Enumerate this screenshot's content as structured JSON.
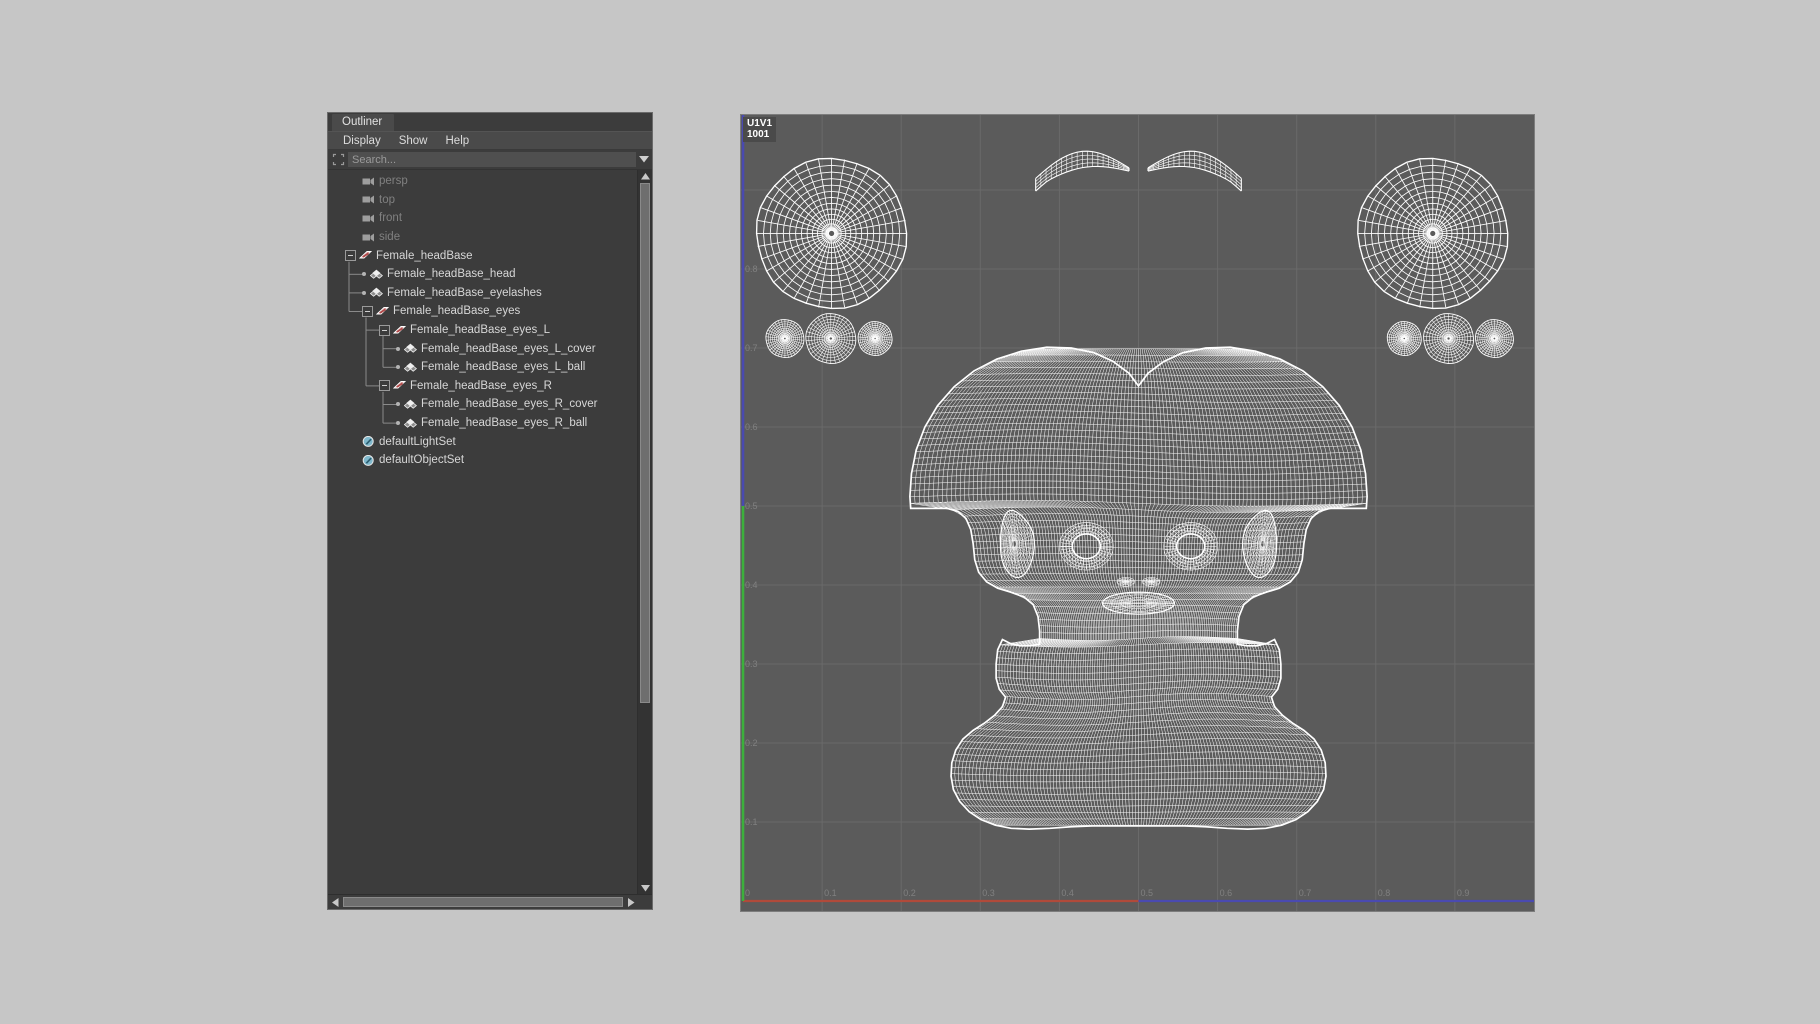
{
  "app": {
    "background_color": "#c6c6c6"
  },
  "outliner": {
    "title": "Outliner",
    "menus": [
      {
        "label": "Display"
      },
      {
        "label": "Show"
      },
      {
        "label": "Help"
      }
    ],
    "search": {
      "placeholder": "Search...",
      "value": "",
      "icon": "search-select-icon",
      "dropdown_icon": "chevron-down-icon"
    },
    "tree": [
      {
        "label": "persp",
        "depth": 1,
        "icon": "camera-icon",
        "dim": true,
        "expander": false,
        "dot": false
      },
      {
        "label": "top",
        "depth": 1,
        "icon": "camera-icon",
        "dim": true,
        "expander": false,
        "dot": false
      },
      {
        "label": "front",
        "depth": 1,
        "icon": "camera-icon",
        "dim": true,
        "expander": false,
        "dot": false
      },
      {
        "label": "side",
        "depth": 1,
        "icon": "camera-icon",
        "dim": true,
        "expander": false,
        "dot": false
      },
      {
        "label": "Female_headBase",
        "depth": 0,
        "icon": "transform-icon",
        "dim": false,
        "expander": true,
        "dot": false
      },
      {
        "label": "Female_headBase_head",
        "depth": 1,
        "icon": "mesh-icon",
        "dim": false,
        "expander": false,
        "dot": true
      },
      {
        "label": "Female_headBase_eyelashes",
        "depth": 1,
        "icon": "mesh-icon",
        "dim": false,
        "expander": false,
        "dot": true
      },
      {
        "label": "Female_headBase_eyes",
        "depth": 1,
        "icon": "transform-icon",
        "dim": false,
        "expander": true,
        "dot": false
      },
      {
        "label": "Female_headBase_eyes_L",
        "depth": 2,
        "icon": "transform-icon",
        "dim": false,
        "expander": true,
        "dot": false
      },
      {
        "label": "Female_headBase_eyes_L_cover",
        "depth": 3,
        "icon": "mesh-icon",
        "dim": false,
        "expander": false,
        "dot": true
      },
      {
        "label": "Female_headBase_eyes_L_ball",
        "depth": 3,
        "icon": "mesh-icon",
        "dim": false,
        "expander": false,
        "dot": true
      },
      {
        "label": "Female_headBase_eyes_R",
        "depth": 2,
        "icon": "transform-icon",
        "dim": false,
        "expander": true,
        "dot": false
      },
      {
        "label": "Female_headBase_eyes_R_cover",
        "depth": 3,
        "icon": "mesh-icon",
        "dim": false,
        "expander": false,
        "dot": true
      },
      {
        "label": "Female_headBase_eyes_R_ball",
        "depth": 3,
        "icon": "mesh-icon",
        "dim": false,
        "expander": false,
        "dot": true
      },
      {
        "label": "defaultLightSet",
        "depth": 1,
        "icon": "set-icon",
        "dim": false,
        "expander": false,
        "dot": false
      },
      {
        "label": "defaultObjectSet",
        "depth": 1,
        "icon": "set-icon",
        "dim": false,
        "expander": false,
        "dot": false
      }
    ],
    "scrollbars": {
      "vertical_up_icon": "triangle-up-icon",
      "vertical_down_icon": "triangle-down-icon",
      "horizontal_left_icon": "triangle-left-icon",
      "horizontal_right_icon": "triangle-right-icon"
    }
  },
  "uv_editor": {
    "tile_label_line1": "U1V1",
    "tile_label_line2": "1001",
    "background_color": "#5b5b5b",
    "wireframe_color": "#ffffff",
    "grid_color": "#6a6a6a",
    "u_axis_color_left": "#b04a3a",
    "u_axis_color_right": "#4a4ab0",
    "v_axis_color_lower": "#3cb03c",
    "v_axis_color_upper": "#4a4ab0",
    "x_ticks": [
      "0",
      "0.1",
      "0.2",
      "0.3",
      "0.4",
      "0.5",
      "0.6",
      "0.7",
      "0.8",
      "0.9"
    ],
    "y_ticks": [
      "0.1",
      "0.2",
      "0.3",
      "0.4",
      "0.5",
      "0.6",
      "0.7",
      "0.8"
    ],
    "shells": [
      {
        "name": "eye-ball-shell-left",
        "type": "radial-disc"
      },
      {
        "name": "eye-ball-shell-right",
        "type": "radial-disc"
      },
      {
        "name": "eyelash-shell-left",
        "type": "curved-strip"
      },
      {
        "name": "eyelash-shell-right",
        "type": "curved-strip"
      },
      {
        "name": "eye-cover-discs-left",
        "type": "small-discs",
        "count": 3
      },
      {
        "name": "eye-cover-discs-right",
        "type": "small-discs",
        "count": 3
      },
      {
        "name": "head-shell",
        "type": "dense-quad-mesh"
      }
    ]
  }
}
